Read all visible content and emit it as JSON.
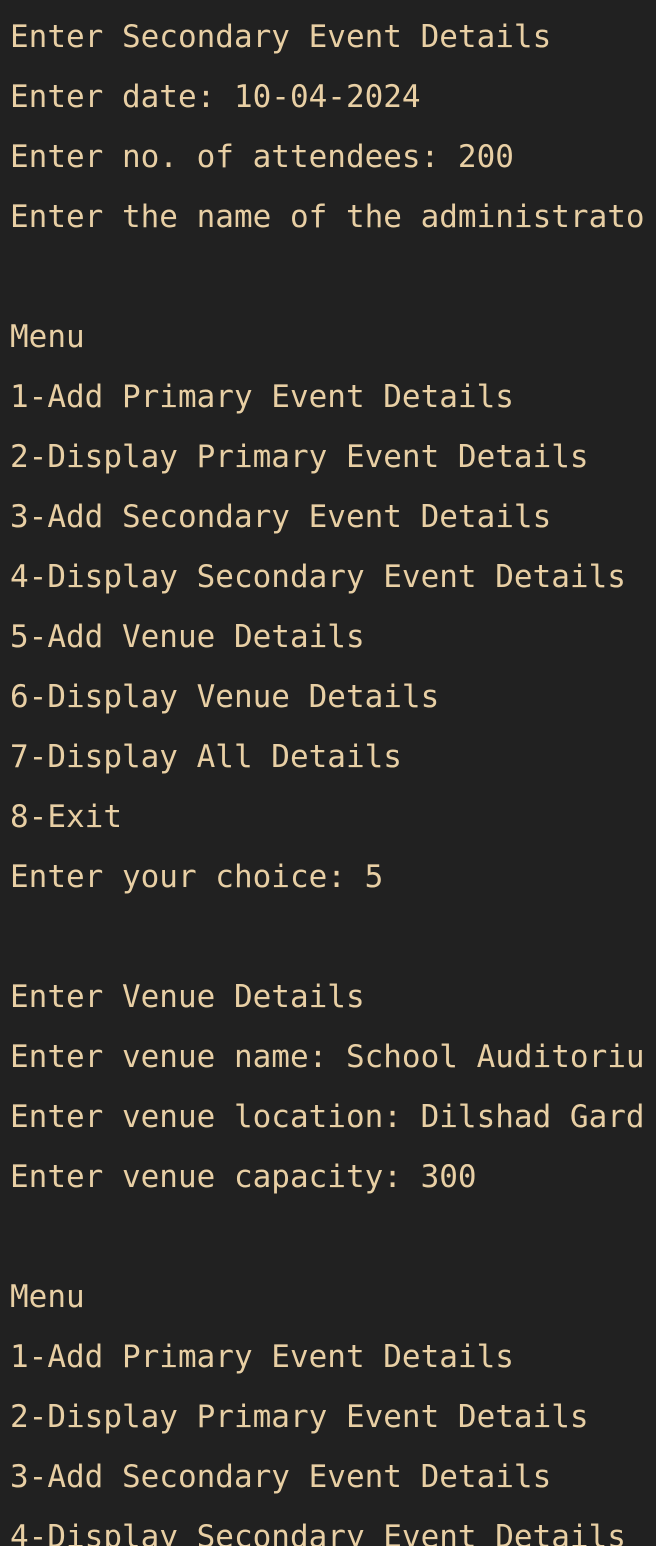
{
  "theme": {
    "background": "#212121",
    "text": "#e8cfa4"
  },
  "terminal": {
    "lines": [
      "Enter Secondary Event Details",
      "Enter date: 10-04-2024",
      "Enter no. of attendees: 200",
      "Enter the name of the administrato",
      "",
      "Menu",
      "1-Add Primary Event Details",
      "2-Display Primary Event Details",
      "3-Add Secondary Event Details",
      "4-Display Secondary Event Details",
      "5-Add Venue Details",
      "6-Display Venue Details",
      "7-Display All Details",
      "8-Exit",
      "Enter your choice: 5",
      "",
      "Enter Venue Details",
      "Enter venue name: School Auditoriu",
      "Enter venue location: Dilshad Gard",
      "Enter venue capacity: 300",
      "",
      "Menu",
      "1-Add Primary Event Details",
      "2-Display Primary Event Details",
      "3-Add Secondary Event Details",
      "4-Display Secondary Event Details"
    ]
  }
}
